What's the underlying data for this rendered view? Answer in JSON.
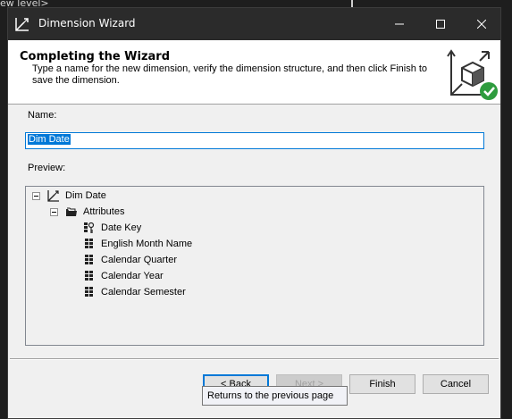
{
  "background": {
    "editor_text": "ew level>"
  },
  "window": {
    "title": "Dimension Wizard",
    "app_icon": "dimension-wizard-icon"
  },
  "header": {
    "title": "Completing the Wizard",
    "description": "Type a name for the new dimension, verify the dimension structure, and then click Finish to save the dimension.",
    "icon": "cube-checkmark-icon"
  },
  "form": {
    "name_label": "Name:",
    "name_value": "Dim Date",
    "preview_label": "Preview:"
  },
  "tree": {
    "root": "Dim Date",
    "folder": "Attributes",
    "attributes": [
      {
        "label": "Date Key",
        "icon": "key-attribute-icon"
      },
      {
        "label": "English Month Name",
        "icon": "attribute-icon"
      },
      {
        "label": "Calendar Quarter",
        "icon": "attribute-icon"
      },
      {
        "label": "Calendar Year",
        "icon": "attribute-icon"
      },
      {
        "label": "Calendar Semester",
        "icon": "attribute-icon"
      }
    ]
  },
  "buttons": {
    "back": "< Back",
    "next": "Next >",
    "finish": "Finish",
    "cancel": "Cancel"
  },
  "tooltip": "Returns to the previous page",
  "colors": {
    "titlebar": "#2b2b2b",
    "accent": "#0078d7",
    "check": "#2e9c3e"
  }
}
